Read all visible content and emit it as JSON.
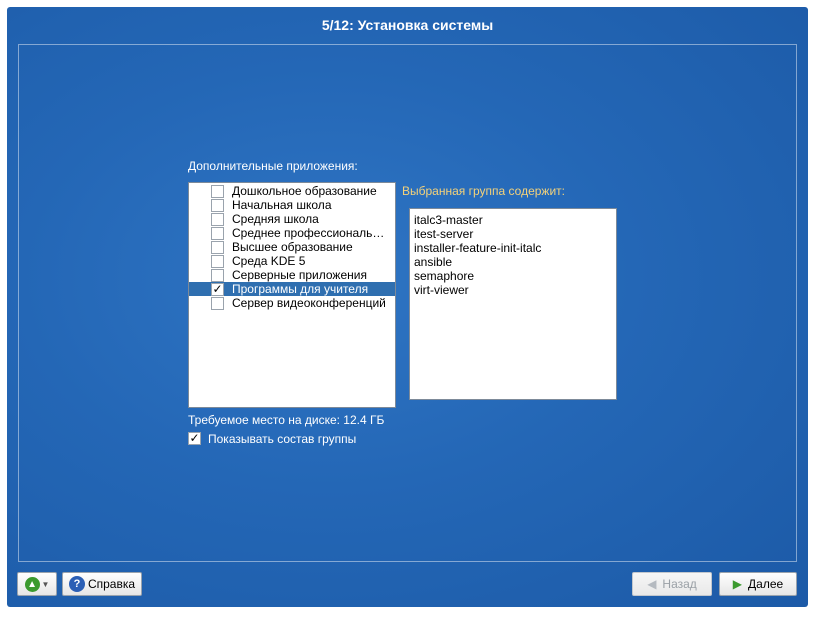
{
  "window": {
    "title": "5/12: Установка системы"
  },
  "groups": {
    "label": "Дополнительные приложения:",
    "items": [
      {
        "label": "Дошкольное образование",
        "checked": false,
        "selected": false
      },
      {
        "label": "Начальная школа",
        "checked": false,
        "selected": false
      },
      {
        "label": "Средняя школа",
        "checked": false,
        "selected": false
      },
      {
        "label": "Среднее профессиональное образование",
        "checked": false,
        "selected": false
      },
      {
        "label": "Высшее образование",
        "checked": false,
        "selected": false
      },
      {
        "label": "Среда KDE 5",
        "checked": false,
        "selected": false
      },
      {
        "label": "Серверные приложения",
        "checked": false,
        "selected": false
      },
      {
        "label": "Программы для учителя",
        "checked": true,
        "selected": true
      },
      {
        "label": "Сервер видеоконференций",
        "checked": false,
        "selected": false
      }
    ]
  },
  "contents": {
    "label": "Выбранная группа содержит:",
    "packages": [
      "italc3-master",
      "itest-server",
      "installer-feature-init-italc",
      "ansible",
      "semaphore",
      "virt-viewer"
    ]
  },
  "disk": {
    "text": "Требуемое место на диске: 12.4 ГБ"
  },
  "show_group": {
    "label": "Показывать состав группы",
    "checked": true
  },
  "buttons": {
    "help": "Справка",
    "back": "Назад",
    "next": "Далее"
  },
  "icons": {
    "up": "up-arrow-icon",
    "help": "help-icon",
    "back": "left-arrow-icon",
    "next": "right-arrow-icon"
  },
  "colors": {
    "background": "#2467b6",
    "selection": "#2f6fb0",
    "accent_label": "#f4d27a",
    "next_arrow": "#3b9a2e"
  }
}
